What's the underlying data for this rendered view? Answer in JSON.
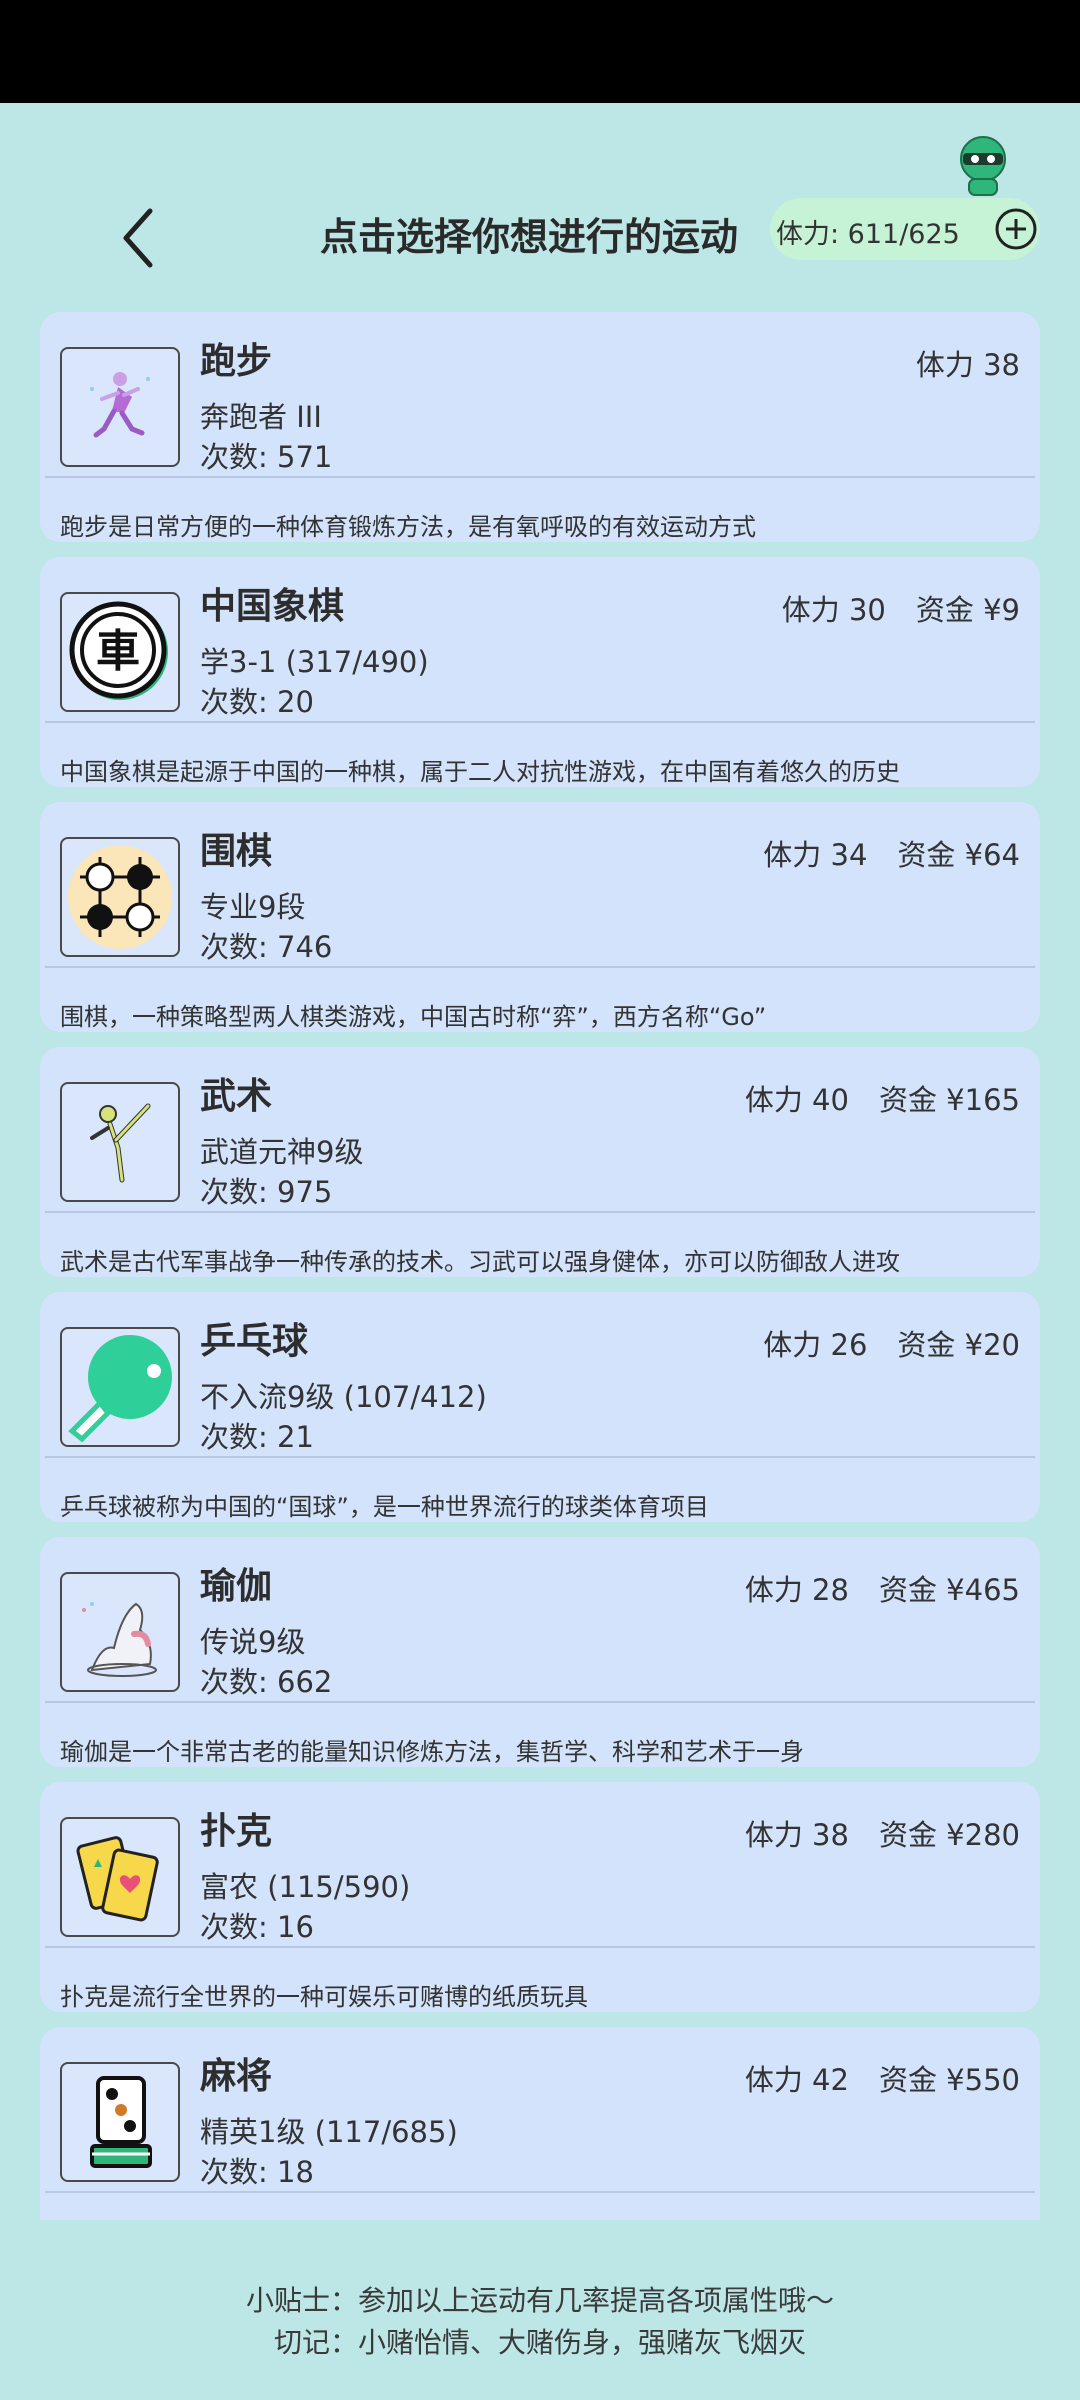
{
  "header": {
    "title": "点击选择你想进行的运动",
    "stamina": "体力: 611/625"
  },
  "activities": [
    {
      "name": "跑步",
      "icon": "running-icon",
      "stamina": "体力 38",
      "fund": "",
      "rank": "奔跑者 III",
      "count": "次数: 571",
      "desc": "跑步是日常方便的一种体育锻炼方法，是有氧呼吸的有效运动方式"
    },
    {
      "name": "中国象棋",
      "icon": "chinese-chess-icon",
      "stamina": "体力 30",
      "fund": "资金 ¥9",
      "rank": "学3-1 (317/490)",
      "count": "次数: 20",
      "desc": "中国象棋是起源于中国的一种棋，属于二人对抗性游戏，在中国有着悠久的历史"
    },
    {
      "name": "围棋",
      "icon": "go-stones-icon",
      "stamina": "体力 34",
      "fund": "资金 ¥64",
      "rank": "专业9段",
      "count": "次数: 746",
      "desc": "围棋，一种策略型两人棋类游戏，中国古时称“弈”，西方名称“Go”"
    },
    {
      "name": "武术",
      "icon": "martial-arts-icon",
      "stamina": "体力 40",
      "fund": "资金 ¥165",
      "rank": "武道元神9级",
      "count": "次数: 975",
      "desc": "武术是古代军事战争一种传承的技术。习武可以强身健体，亦可以防御敌人进攻"
    },
    {
      "name": "乒乓球",
      "icon": "ping-pong-paddle-icon",
      "stamina": "体力 26",
      "fund": "资金 ¥20",
      "rank": "不入流9级 (107/412)",
      "count": "次数: 21",
      "desc": "乒乓球被称为中国的“国球”，是一种世界流行的球类体育项目"
    },
    {
      "name": "瑜伽",
      "icon": "yoga-icon",
      "stamina": "体力 28",
      "fund": "资金 ¥465",
      "rank": "传说9级",
      "count": "次数: 662",
      "desc": "瑜伽是一个非常古老的能量知识修炼方法，集哲学、科学和艺术于一身"
    },
    {
      "name": "扑克",
      "icon": "playing-cards-icon",
      "stamina": "体力 38",
      "fund": "资金 ¥280",
      "rank": "富农 (115/590)",
      "count": "次数: 16",
      "desc": "扑克是流行全世界的一种可娱乐可赌博的纸质玩具"
    },
    {
      "name": "麻将",
      "icon": "mahjong-tile-icon",
      "stamina": "体力 42",
      "fund": "资金 ¥550",
      "rank": "精英1级 (117/685)",
      "count": "次数: 18",
      "desc": ""
    }
  ],
  "tips": {
    "line1": "小贴士：参加以上运动有几率提高各项属性哦～",
    "line2": "切记：小赌怡情、大赌伤身，强赌灰飞烟灭"
  },
  "colors": {
    "background": "#bde6e6",
    "card": "#d3e3fb",
    "stamina_pill": "#c6f3d6",
    "accent_green": "#2fb67a"
  }
}
